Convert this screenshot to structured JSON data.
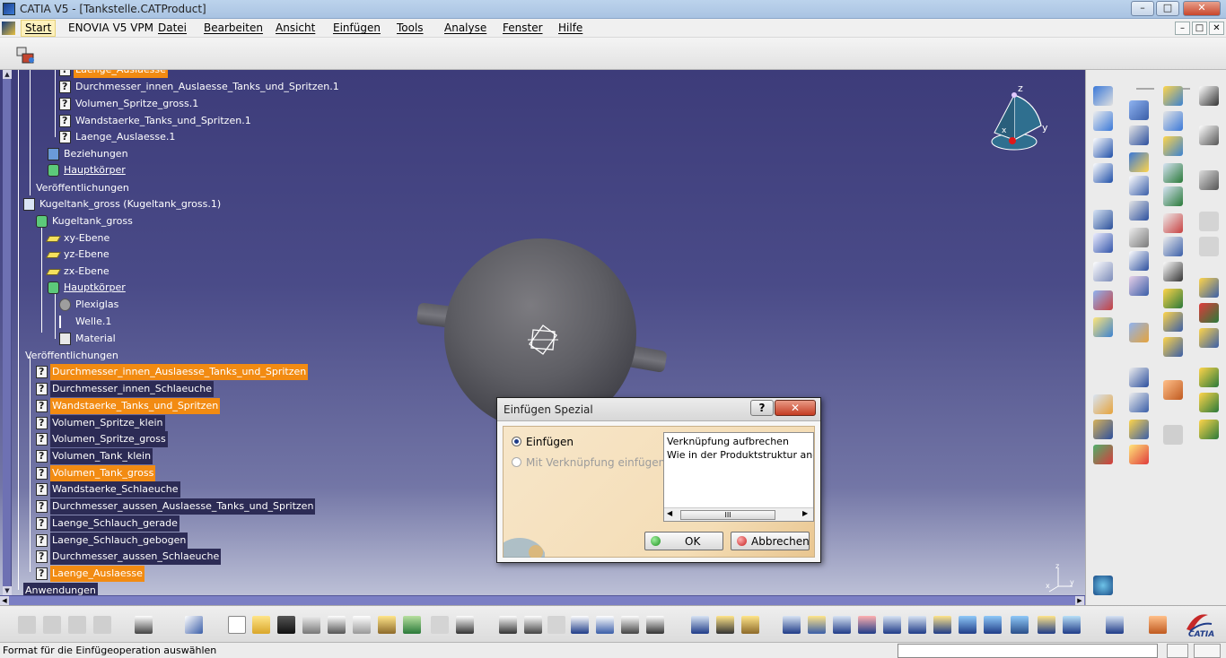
{
  "window": {
    "title": "CATIA V5 - [Tankstelle.CATProduct]",
    "controls": {
      "minimize": "–",
      "maximize": "□",
      "close": "✕"
    }
  },
  "menubar": {
    "items": [
      "Start",
      "ENOVIA V5 VPM",
      "Datei",
      "Bearbeiten",
      "Ansicht",
      "Einfügen",
      "Tools",
      "Analyse",
      "Fenster",
      "Hilfe"
    ],
    "doc_controls": [
      "–",
      "□",
      "✕"
    ]
  },
  "tree": {
    "nodes": [
      {
        "label": "Laenge_Auslaesse",
        "icon": "parameter-icon",
        "style": "orange"
      },
      {
        "label": "Durchmesser_innen_Auslaesse_Tanks_und_Spritzen.1",
        "icon": "parameter-icon",
        "style": "plain"
      },
      {
        "label": "Volumen_Spritze_gross.1",
        "icon": "parameter-icon",
        "style": "plain"
      },
      {
        "label": "Wandstaerke_Tanks_und_Spritzen.1",
        "icon": "parameter-icon",
        "style": "plain"
      },
      {
        "label": "Laenge_Auslaesse.1",
        "icon": "parameter-icon",
        "style": "plain"
      },
      {
        "label": "Beziehungen",
        "icon": "relations-icon",
        "style": "plain"
      },
      {
        "label": "Hauptkörper",
        "icon": "body-icon",
        "style": "underline"
      },
      {
        "label": "Veröffentlichungen",
        "icon": "publication-icon",
        "style": "plain"
      },
      {
        "label": "Kugeltank_gross (Kugeltank_gross.1)",
        "icon": "product-icon",
        "style": "plain"
      },
      {
        "label": "Kugeltank_gross",
        "icon": "part-icon",
        "style": "plain"
      },
      {
        "label": "xy-Ebene",
        "icon": "plane-icon",
        "style": "plain"
      },
      {
        "label": "yz-Ebene",
        "icon": "plane-icon",
        "style": "plain"
      },
      {
        "label": "zx-Ebene",
        "icon": "plane-icon",
        "style": "plain"
      },
      {
        "label": "Hauptkörper",
        "icon": "body-icon",
        "style": "underline"
      },
      {
        "label": "Plexiglas",
        "icon": "material-icon",
        "style": "plain"
      },
      {
        "label": "Welle.1",
        "icon": "shaft-icon",
        "style": "plain"
      },
      {
        "label": "Material",
        "icon": "doc-icon",
        "style": "plain"
      },
      {
        "label": "Veröffentlichungen",
        "icon": "publication-icon",
        "style": "plain"
      },
      {
        "label": "Durchmesser_innen_Auslaesse_Tanks_und_Spritzen",
        "icon": "parameter-icon",
        "style": "orange"
      },
      {
        "label": "Durchmesser_innen_Schlaeuche",
        "icon": "parameter-icon",
        "style": "dark"
      },
      {
        "label": "Wandstaerke_Tanks_und_Spritzen",
        "icon": "parameter-icon",
        "style": "orange"
      },
      {
        "label": "Volumen_Spritze_klein",
        "icon": "parameter-icon",
        "style": "dark"
      },
      {
        "label": "Volumen_Spritze_gross",
        "icon": "parameter-icon",
        "style": "dark"
      },
      {
        "label": "Volumen_Tank_klein",
        "icon": "parameter-icon",
        "style": "dark"
      },
      {
        "label": "Volumen_Tank_gross",
        "icon": "parameter-icon",
        "style": "orange"
      },
      {
        "label": "Wandstaerke_Schlaeuche",
        "icon": "parameter-icon",
        "style": "dark"
      },
      {
        "label": "Durchmesser_aussen_Auslaesse_Tanks_und_Spritzen",
        "icon": "parameter-icon",
        "style": "dark"
      },
      {
        "label": "Laenge_Schlauch_gerade",
        "icon": "parameter-icon",
        "style": "dark"
      },
      {
        "label": "Laenge_Schlauch_gebogen",
        "icon": "parameter-icon",
        "style": "dark"
      },
      {
        "label": "Durchmesser_aussen_Schlaeuche",
        "icon": "parameter-icon",
        "style": "dark"
      },
      {
        "label": "Laenge_Auslaesse",
        "icon": "parameter-icon",
        "style": "orange"
      },
      {
        "label": "Anwendungen",
        "icon": "applications-icon",
        "style": "dark"
      }
    ]
  },
  "compass": {
    "x": "x",
    "y": "y",
    "z": "z"
  },
  "dialog": {
    "title": "Einfügen Spezial",
    "help_label": "?",
    "close_label": "✕",
    "option_insert": "Einfügen",
    "option_insert_with_link": "Mit Verknüpfung einfügen",
    "list": [
      "Verknüpfung aufbrechen",
      "Wie in der Produktstruktur angegeben"
    ],
    "scroll_thumb": "III",
    "ok_label": "OK",
    "cancel_label": "Abbrechen"
  },
  "statusbar": {
    "text": "Format für die Einfügeoperation auswählen"
  },
  "catia_logo": "CATIA",
  "colors": {
    "highlight_orange": "#f28b12",
    "highlight_dark": "#2c2b55",
    "viewport_top": "#3d3c7a"
  }
}
